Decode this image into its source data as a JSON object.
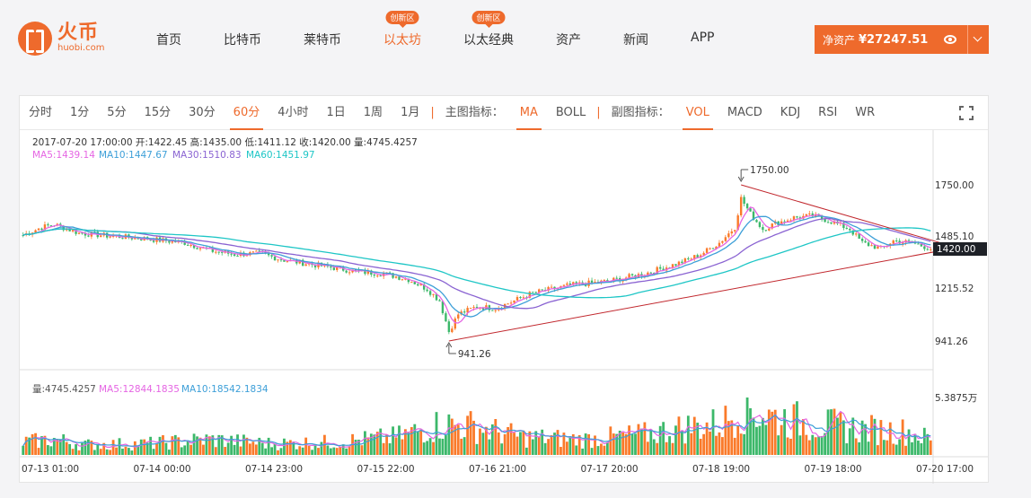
{
  "brand": {
    "name_cn": "火币",
    "name_en": "huobi.com"
  },
  "nav": [
    {
      "label": "首页",
      "active": false,
      "badge": ""
    },
    {
      "label": "比特币",
      "active": false,
      "badge": ""
    },
    {
      "label": "莱特币",
      "active": false,
      "badge": ""
    },
    {
      "label": "以太坊",
      "active": true,
      "badge": "创新区"
    },
    {
      "label": "以太经典",
      "active": false,
      "badge": "创新区"
    },
    {
      "label": "资产",
      "active": false,
      "badge": ""
    },
    {
      "label": "新闻",
      "active": false,
      "badge": ""
    },
    {
      "label": "APP",
      "active": false,
      "badge": ""
    }
  ],
  "asset": {
    "label": "净资产",
    "value": "¥27247.51"
  },
  "toolbar": {
    "periods": [
      "分时",
      "1分",
      "5分",
      "15分",
      "30分",
      "60分",
      "4小时",
      "1日",
      "1周",
      "1月"
    ],
    "active_period": "60分",
    "main_label": "主图指标：",
    "main_indicators": [
      "MA",
      "BOLL"
    ],
    "active_main": "MA",
    "sub_label": "副图指标：",
    "sub_indicators": [
      "VOL",
      "MACD",
      "KDJ",
      "RSI",
      "WR"
    ],
    "active_sub": "VOL"
  },
  "ohlc_info": {
    "line1": "2017-07-20 17:00:00    开:1422.45  高:1435.00  低:1411.12  收:1420.00  量:4745.4257",
    "ma5": "MA5:1439.14",
    "ma10": "MA10:1447.67",
    "ma30": "MA30:1510.83",
    "ma60": "MA60:1451.97"
  },
  "vol_info": {
    "vol": "量:4745.4257",
    "ma5": "MA5:12844.1835",
    "ma10": "MA10:18542.1834"
  },
  "colors": {
    "accent": "#ee6a2c",
    "up": "#fa7a2a",
    "down": "#3cb86a",
    "ma5": "#e565e3",
    "ma10": "#3d9fd8",
    "ma30": "#8a63d2",
    "ma60": "#1ec6c6",
    "trend": "#c1272d"
  },
  "chart_data": {
    "type": "candlestick",
    "price_axis_labels": [
      "1750.00",
      "1485.10",
      "1215.52",
      "941.26"
    ],
    "price_axis_values": [
      1750,
      1485.1,
      1215.52,
      941.26
    ],
    "current_price": "1420.00",
    "volume_axis_label": "5.3875万",
    "x_ticks": [
      "07-13 01:00",
      "07-14 00:00",
      "07-14 23:00",
      "07-15 22:00",
      "07-16 21:00",
      "07-17 20:00",
      "07-18 19:00",
      "07-19 18:00",
      "07-20 17:00"
    ],
    "annotations": [
      {
        "label": "1750.00",
        "type": "high"
      },
      {
        "label": "941.26",
        "type": "low"
      }
    ],
    "price_anchors": [
      [
        0,
        1490
      ],
      [
        6,
        1530
      ],
      [
        10,
        1545
      ],
      [
        18,
        1500
      ],
      [
        28,
        1485
      ],
      [
        40,
        1470
      ],
      [
        52,
        1450
      ],
      [
        60,
        1410
      ],
      [
        68,
        1390
      ],
      [
        76,
        1395
      ],
      [
        84,
        1360
      ],
      [
        92,
        1340
      ],
      [
        100,
        1320
      ],
      [
        108,
        1300
      ],
      [
        116,
        1290
      ],
      [
        124,
        1260
      ],
      [
        130,
        1210
      ],
      [
        134,
        1150
      ],
      [
        137,
        990
      ],
      [
        140,
        1080
      ],
      [
        146,
        1120
      ],
      [
        152,
        1110
      ],
      [
        158,
        1150
      ],
      [
        164,
        1190
      ],
      [
        170,
        1210
      ],
      [
        176,
        1230
      ],
      [
        182,
        1240
      ],
      [
        188,
        1250
      ],
      [
        194,
        1270
      ],
      [
        200,
        1290
      ],
      [
        206,
        1320
      ],
      [
        212,
        1350
      ],
      [
        218,
        1390
      ],
      [
        224,
        1450
      ],
      [
        229,
        1530
      ],
      [
        231,
        1680
      ],
      [
        234,
        1600
      ],
      [
        238,
        1520
      ],
      [
        242,
        1550
      ],
      [
        248,
        1580
      ],
      [
        254,
        1590
      ],
      [
        260,
        1560
      ],
      [
        266,
        1520
      ],
      [
        270,
        1450
      ],
      [
        276,
        1420
      ],
      [
        280,
        1460
      ],
      [
        286,
        1450
      ],
      [
        290,
        1430
      ],
      [
        292,
        1420
      ]
    ],
    "volume_anchors": [
      [
        0,
        0.25
      ],
      [
        10,
        0.3
      ],
      [
        20,
        0.2
      ],
      [
        40,
        0.22
      ],
      [
        60,
        0.3
      ],
      [
        80,
        0.22
      ],
      [
        100,
        0.25
      ],
      [
        120,
        0.35
      ],
      [
        135,
        0.6
      ],
      [
        145,
        0.55
      ],
      [
        160,
        0.35
      ],
      [
        180,
        0.3
      ],
      [
        200,
        0.4
      ],
      [
        215,
        0.55
      ],
      [
        225,
        0.6
      ],
      [
        231,
        0.95
      ],
      [
        240,
        0.75
      ],
      [
        255,
        0.6
      ],
      [
        270,
        0.5
      ],
      [
        285,
        0.45
      ],
      [
        292,
        0.3
      ]
    ],
    "candle_count": 293
  }
}
